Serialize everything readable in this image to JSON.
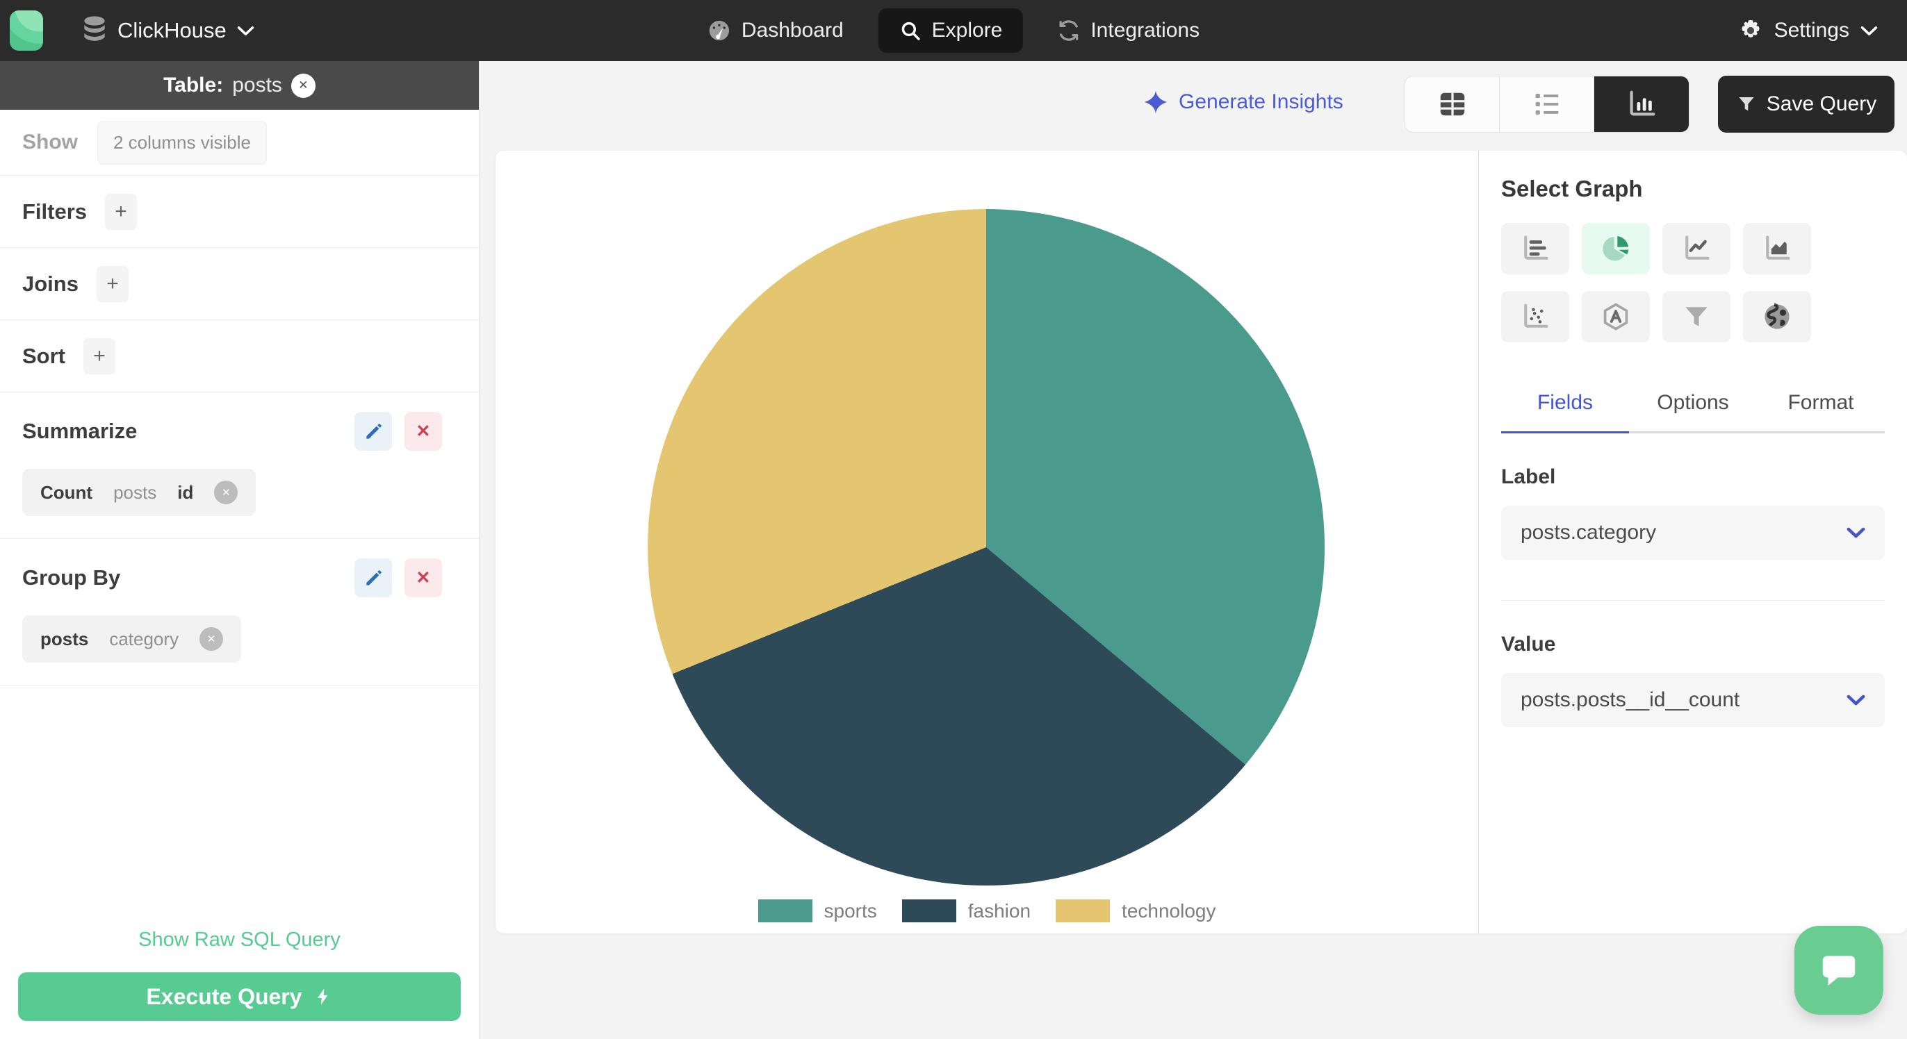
{
  "navbar": {
    "app": "ClickHouse",
    "items": [
      {
        "label": "Dashboard",
        "icon": "dashboard-icon",
        "active": false
      },
      {
        "label": "Explore",
        "icon": "search-icon",
        "active": true
      },
      {
        "label": "Integrations",
        "icon": "sync-icon",
        "active": false
      }
    ],
    "settings_label": "Settings"
  },
  "sidebar": {
    "table_header": {
      "prefix": "Table:",
      "name": "posts"
    },
    "show": {
      "label": "Show",
      "chip": "2 columns visible"
    },
    "sections": [
      {
        "label": "Filters",
        "add_label": "+"
      },
      {
        "label": "Joins",
        "add_label": "+"
      },
      {
        "label": "Sort",
        "add_label": "+"
      }
    ],
    "summarize": {
      "label": "Summarize",
      "chip": {
        "agg": "Count",
        "table": "posts",
        "field": "id"
      }
    },
    "group_by": {
      "label": "Group By",
      "chip": {
        "table": "posts",
        "field": "category"
      }
    },
    "raw_sql_link": "Show Raw SQL Query",
    "execute_button": "Execute Query"
  },
  "toolbar": {
    "generate_insights": "Generate Insights",
    "save_query": "Save Query",
    "view_toggles": [
      {
        "id": "table",
        "icon": "table-view-icon",
        "active": false
      },
      {
        "id": "list",
        "icon": "list-view-icon",
        "active": false
      },
      {
        "id": "chart",
        "icon": "chart-view-icon",
        "active": true
      }
    ]
  },
  "graph_panel": {
    "title": "Select Graph",
    "graph_types": [
      {
        "id": "bar",
        "icon": "bar-chart-icon",
        "active": false
      },
      {
        "id": "pie",
        "icon": "pie-chart-icon",
        "active": true
      },
      {
        "id": "line",
        "icon": "line-chart-icon",
        "active": false
      },
      {
        "id": "area",
        "icon": "area-chart-icon",
        "active": false
      },
      {
        "id": "scatter",
        "icon": "scatter-chart-icon",
        "active": false
      },
      {
        "id": "radar",
        "icon": "radar-chart-icon",
        "active": false
      },
      {
        "id": "funnel",
        "icon": "funnel-chart-icon",
        "active": false
      },
      {
        "id": "geo",
        "icon": "geo-chart-icon",
        "active": false
      }
    ],
    "tabs": [
      {
        "label": "Fields",
        "active": true
      },
      {
        "label": "Options",
        "active": false
      },
      {
        "label": "Format",
        "active": false
      }
    ],
    "label_field": {
      "heading": "Label",
      "value": "posts.category"
    },
    "value_field": {
      "heading": "Value",
      "value": "posts.posts__id__count"
    }
  },
  "chart_data": {
    "type": "pie",
    "title": "",
    "categories": [
      "sports",
      "fashion",
      "technology"
    ],
    "values": [
      36.1,
      32.8,
      31.1
    ],
    "values_note": "percent of circle, estimated from slice angles (no numeric labels shown)",
    "slice_angles_deg": [
      [
        0,
        130
      ],
      [
        130,
        248
      ],
      [
        248,
        360
      ]
    ],
    "colors": [
      "#4a9b8e",
      "#2e4a59",
      "#e5c670"
    ],
    "legend_position": "bottom"
  },
  "colors": {
    "navbar_bg": "#2b2b2b",
    "active_pill_bg": "#171717",
    "table_header_bg": "#4a4a4a",
    "accent_green": "#57cb92",
    "accent_indigo": "#4a5cd0",
    "active_graph_bg": "#e7faf2",
    "page_bg": "#f3f3f4"
  }
}
